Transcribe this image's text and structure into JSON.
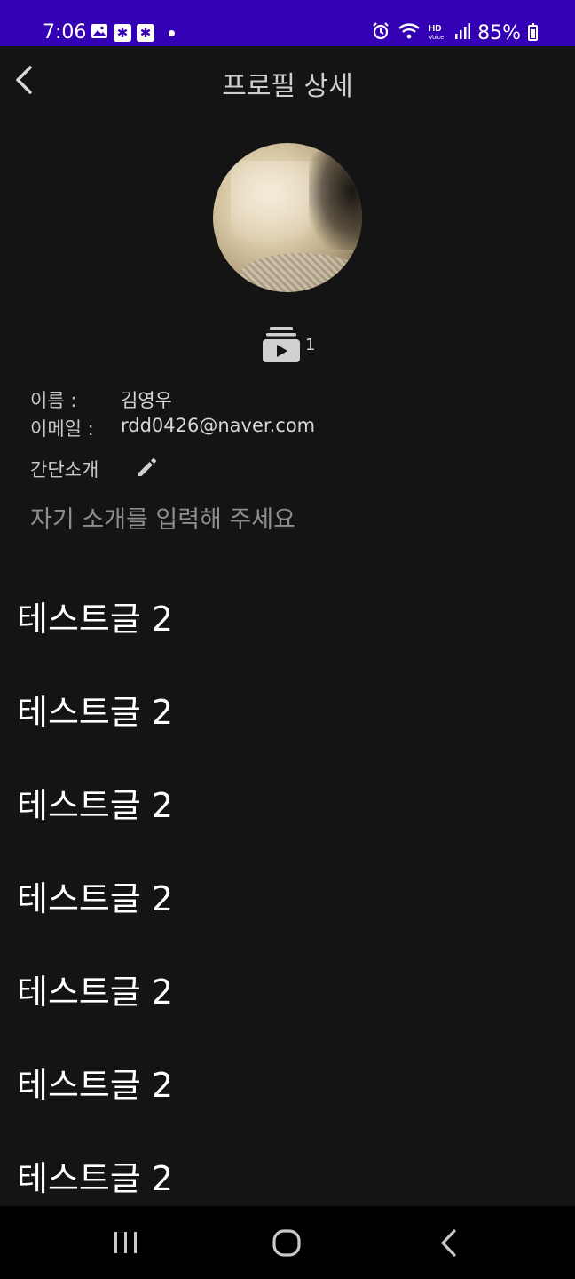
{
  "status_bar": {
    "time": "7:06",
    "battery": "85%",
    "colors": {
      "background": "#3300b3"
    }
  },
  "app_bar": {
    "title": "프로필 상세"
  },
  "profile": {
    "video_count": "1",
    "name_label": "이름 :",
    "name_value": "김영우",
    "email_label": "이메일 :",
    "email_value": "rdd0426@naver.com",
    "intro_label": "간단소개",
    "intro_placeholder": "자기 소개를 입력해 주세요"
  },
  "posts": [
    {
      "title": "테스트글 2"
    },
    {
      "title": "테스트글 2"
    },
    {
      "title": "테스트글 2"
    },
    {
      "title": "테스트글 2"
    },
    {
      "title": "테스트글 2"
    },
    {
      "title": "테스트글 2"
    },
    {
      "title": "테스트글 2"
    }
  ],
  "theme": {
    "background": "#141414",
    "nav_background": "#000000"
  }
}
